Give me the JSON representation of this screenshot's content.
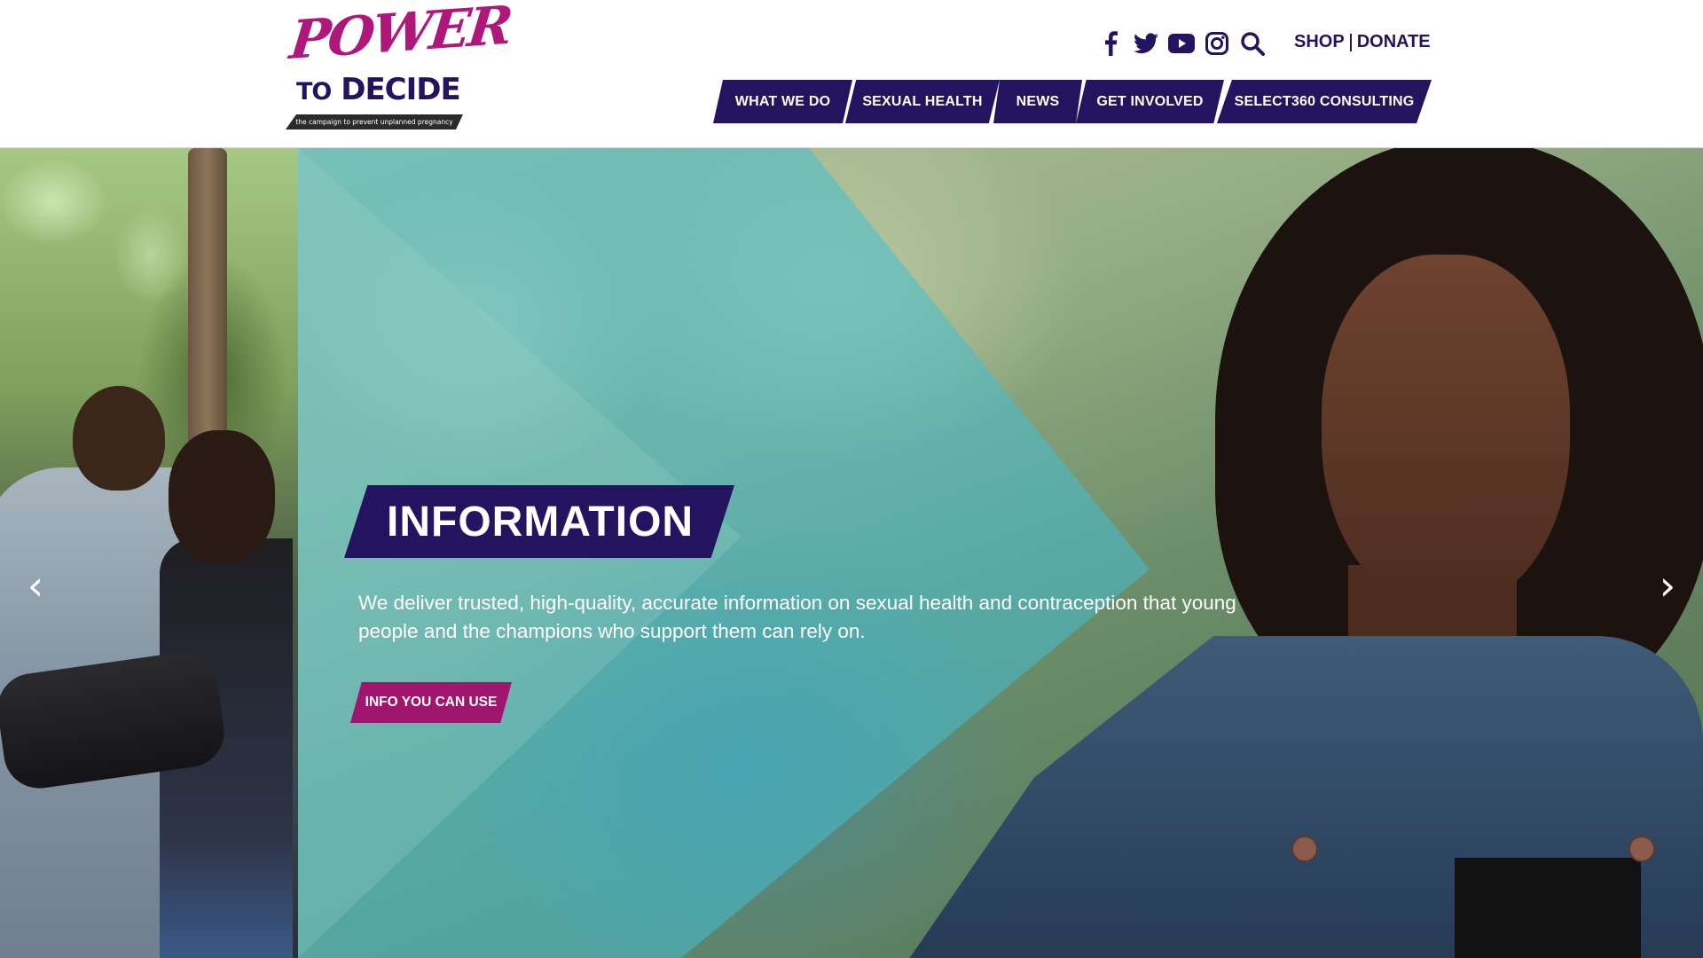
{
  "logo": {
    "word_power": "POWER",
    "word_to": "TO",
    "word_decide": "DECIDE",
    "tagline": "the campaign to prevent unplanned pregnancy"
  },
  "social": [
    {
      "name": "facebook-icon"
    },
    {
      "name": "twitter-icon"
    },
    {
      "name": "youtube-icon"
    },
    {
      "name": "instagram-icon"
    },
    {
      "name": "search-icon"
    }
  ],
  "utility": {
    "shop": "SHOP",
    "donate": "DONATE"
  },
  "nav": {
    "items": [
      {
        "label": "WHAT WE DO"
      },
      {
        "label": "SEXUAL HEALTH"
      },
      {
        "label": "NEWS"
      },
      {
        "label": "GET INVOLVED"
      },
      {
        "label": "SELECT360 CONSULTING"
      }
    ]
  },
  "hero": {
    "title": "INFORMATION",
    "description": "We deliver trusted, high-quality, accurate information on sexual health and contraception that young people and the champions who support them can rely on.",
    "cta": "INFO YOU CAN USE",
    "prev_arrow": "‹",
    "next_arrow": "›"
  },
  "colors": {
    "brand_purple": "#24135f",
    "brand_magenta": "#a0166f"
  }
}
